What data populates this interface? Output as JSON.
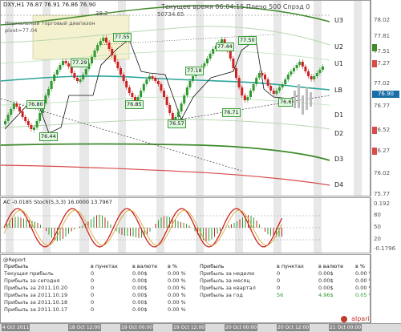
{
  "header": {
    "symbol": "DXY,H1",
    "ohlc": "76.87 76.91 76.86 76.90",
    "server_info": "Текущее время 06:04:15 Плечо 500 Спрэд 0",
    "range_value": "38.2",
    "mid_value": "50734.65",
    "pivot_caption": "Нормальный торговый диапазон",
    "pivot_value": "pivot=77.04"
  },
  "levels": {
    "u3": "U3",
    "u2": "U2",
    "u1": "U1",
    "lb": "LB",
    "d1": "D1",
    "d2": "D2",
    "d3": "D3",
    "d4": "D4"
  },
  "price_axis": [
    "78.02",
    "77.81",
    "77.51",
    "77.27",
    "77.02",
    "76.77",
    "76.52",
    "76.27",
    "76.02",
    "75.77"
  ],
  "current_price": "76.90",
  "pivot_labels": [
    "76.80",
    "77.29",
    "77.55",
    "76.44",
    "76.85",
    "77.18",
    "76.57",
    "77.44",
    "77.50",
    "76.71",
    "76.6"
  ],
  "indicator": {
    "title": "AC -0.0185  Stoch(5,3,3) 16.0000 13.7967",
    "axis": [
      "0.192",
      "80",
      "50",
      "20",
      "-0.1796"
    ]
  },
  "report": {
    "title": "@Report",
    "left_headers": [
      "Прибыль",
      "в пунктах",
      "в валюте",
      "в %"
    ],
    "left_rows": [
      [
        "Текущая прибыль",
        "0",
        "0.00$",
        "0.00 %"
      ],
      [
        "Прибыль за сегодня",
        "0",
        "0.00$",
        "0.00 %"
      ],
      [
        "Прибыль за 2011.10.20",
        "0",
        "0.00$",
        "0.00 %"
      ],
      [
        "Прибыль за 2011.10.19",
        "0",
        "0.00$",
        "0.00 %"
      ],
      [
        "Прибыль за 2011.10.18",
        "0",
        "0.00$",
        "0.00 %"
      ],
      [
        "Прибыль за 2011.10.17",
        "0",
        "0.00$",
        "0.00 %"
      ]
    ],
    "right_headers": [
      "Прибыль",
      "в пунктах",
      "в валюте",
      "в %"
    ],
    "right_rows": [
      [
        "Прибыль за неделю",
        "0",
        "0.00$",
        "0.00 %"
      ],
      [
        "Прибыль за месяц",
        "0",
        "0.00$",
        "0.00 %"
      ],
      [
        "Прибыль за квартал",
        "0",
        "0.00$",
        "0.00 %"
      ],
      [
        "Прибыль за год",
        "56",
        "4.96$",
        "0.05 %"
      ]
    ],
    "brand": "alpari"
  },
  "time_axis": [
    "4 Oct 2011",
    "18 Oct 12:00",
    "19 Oct 00:00",
    "19 Oct 12:00",
    "20 Oct 00:00",
    "20 Oct 12:00",
    "21 Oct 00:00"
  ],
  "colors": {
    "up": "#2e9a2e",
    "down": "#cc2222",
    "lb_line": "#2aa59a",
    "d4_line": "#d94a4a",
    "level_green": "#3f8a2a",
    "alpari": "#c0392b"
  }
}
